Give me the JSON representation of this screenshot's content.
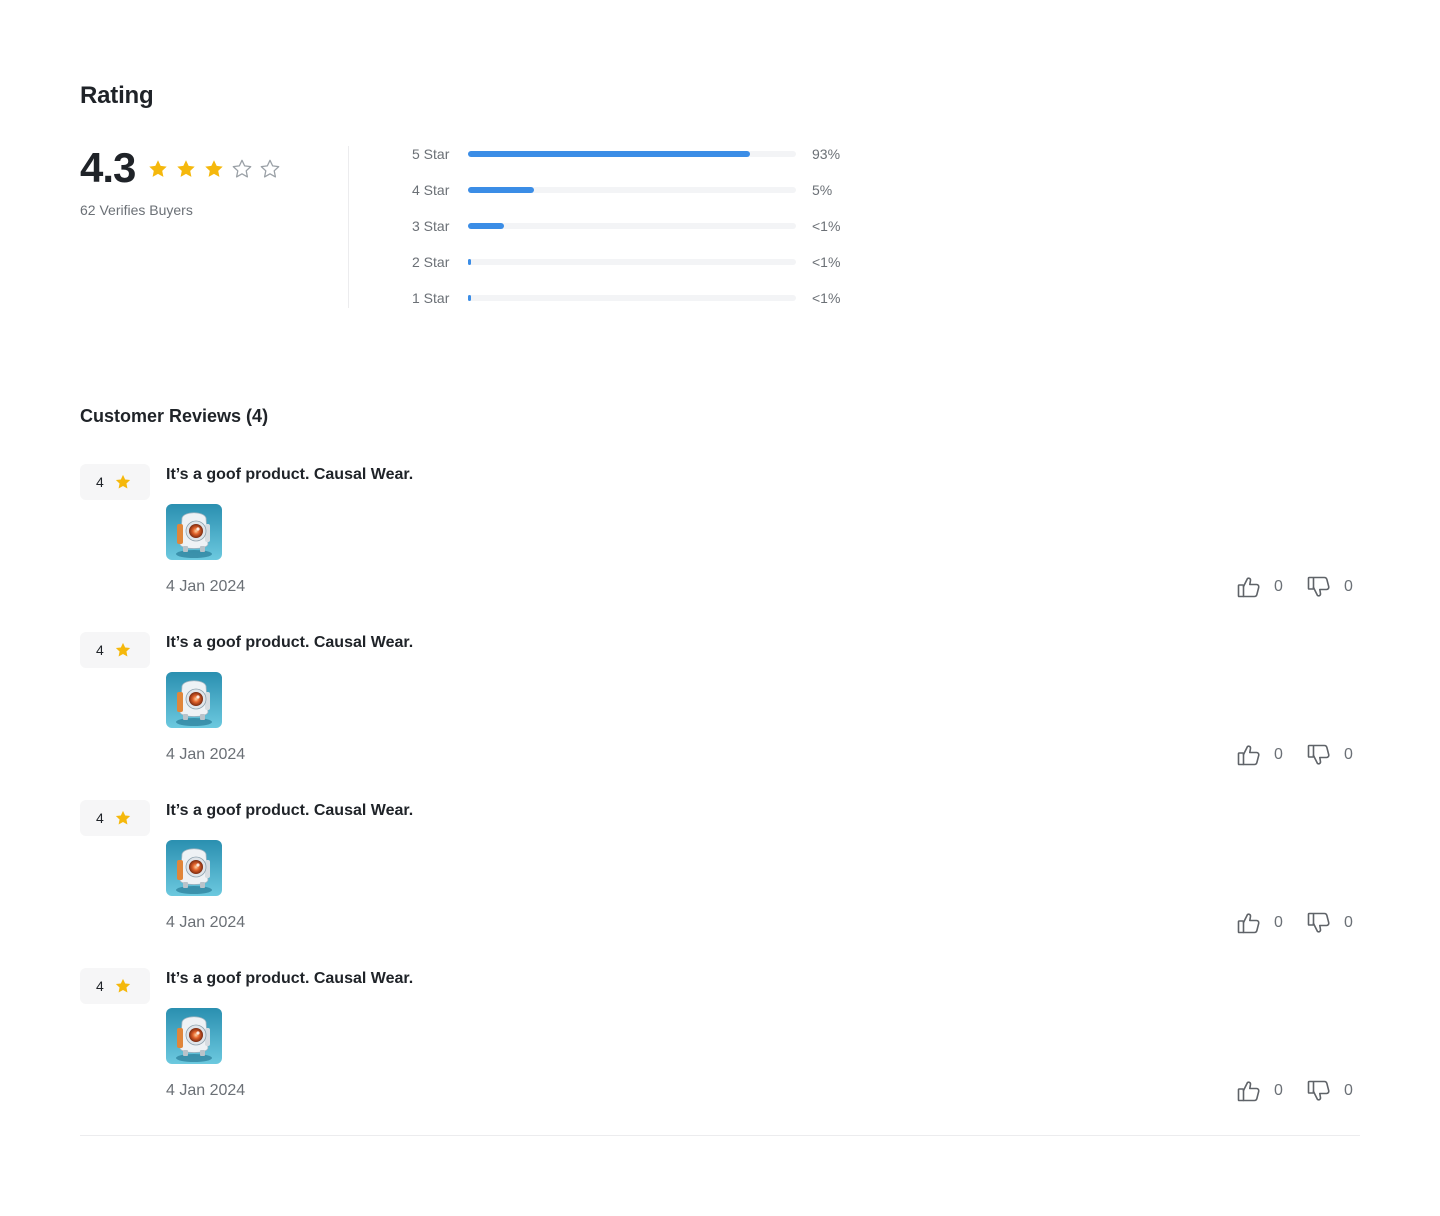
{
  "rating": {
    "title": "Rating",
    "score": "4.3",
    "stars": [
      {
        "icon": "star-filled-icon"
      },
      {
        "icon": "star-filled-icon"
      },
      {
        "icon": "star-filled-icon"
      },
      {
        "icon": "star-outline-icon"
      },
      {
        "icon": "star-outline-icon"
      }
    ],
    "buyers_text": "62 Verifies Buyers",
    "star_color": "#f5b80c",
    "empty_star_color": "#9aa0a6"
  },
  "distribution": [
    {
      "label": "5 Star",
      "fraction": 0.86,
      "pct_text": "93%"
    },
    {
      "label": "4 Star",
      "fraction": 0.2,
      "pct_text": "5%"
    },
    {
      "label": "3 Star",
      "fraction": 0.11,
      "pct_text": "<1%"
    },
    {
      "label": "2 Star",
      "fraction": 0.006,
      "pct_text": "<1%"
    },
    {
      "label": "1 Star",
      "fraction": 0.006,
      "pct_text": "<1%"
    }
  ],
  "bar_color": "#3b8de6",
  "reviews_title": "Customer Reviews (4)",
  "reviews": [
    {
      "rating": "4",
      "text": "It’s a goof product. Causal Wear.",
      "date": "4 Jan 2024",
      "likes": "0",
      "dislikes": "0"
    },
    {
      "rating": "4",
      "text": "It’s a goof product. Causal Wear.",
      "date": "4 Jan 2024",
      "likes": "0",
      "dislikes": "0"
    },
    {
      "rating": "4",
      "text": "It’s a goof product. Causal Wear.",
      "date": "4 Jan 2024",
      "likes": "0",
      "dislikes": "0"
    },
    {
      "rating": "4",
      "text": "It’s a goof product. Causal Wear.",
      "date": "4 Jan 2024",
      "likes": "0",
      "dislikes": "0"
    }
  ]
}
